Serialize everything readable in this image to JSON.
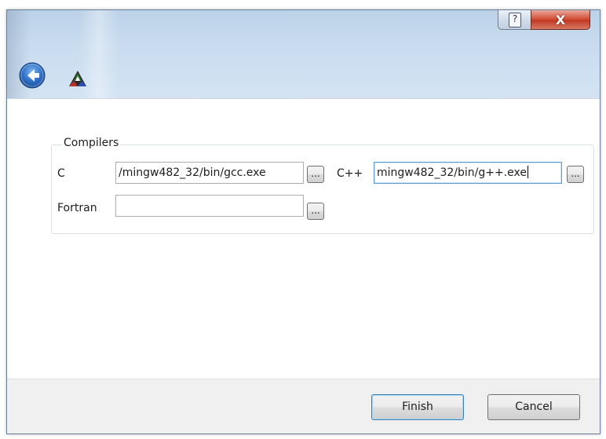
{
  "window": {
    "help_glyph": "?",
    "close_glyph": "X"
  },
  "icons": {
    "back": "back-arrow-icon",
    "app": "app-logo-icon",
    "help": "help-icon",
    "close": "close-icon"
  },
  "compilers": {
    "group_title": "Compilers",
    "c_label": "C",
    "c_value": "/mingw482_32/bin/gcc.exe",
    "cpp_label": "C++",
    "cpp_value": "mingw482_32/bin/g++.exe",
    "fortran_label": "Fortran",
    "fortran_value": "",
    "browse_label": "..."
  },
  "footer": {
    "finish_label": "Finish",
    "cancel_label": "Cancel"
  }
}
